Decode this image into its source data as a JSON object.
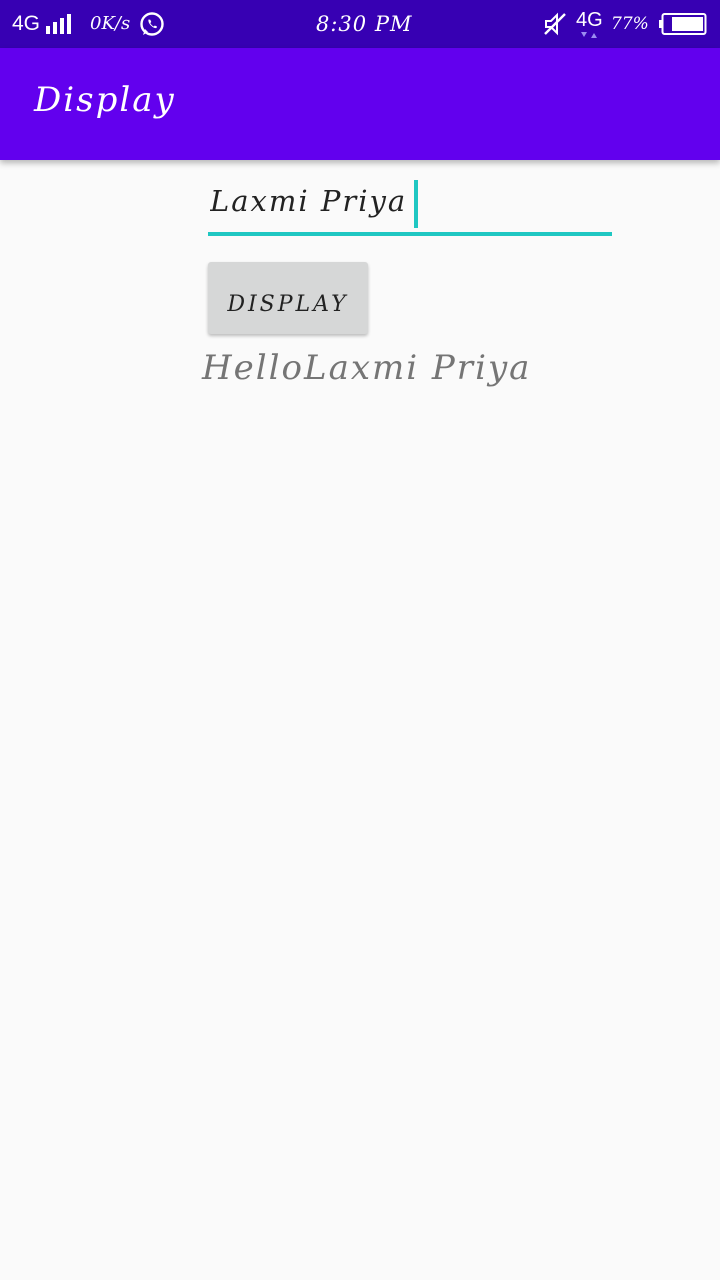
{
  "status_bar": {
    "network_left": "4G",
    "speed": "0K/s",
    "time": "8:30 PM",
    "network_right": "4G",
    "battery": "77%",
    "icons": [
      "signal-icon",
      "whatsapp-icon",
      "mute-icon",
      "data-arrows-icon",
      "battery-icon"
    ]
  },
  "app_bar": {
    "title": "Display",
    "color": "#6200ee"
  },
  "form": {
    "name_value": "Laxmi Priya",
    "accent_color": "#1fc7c2",
    "button_label": "DISPLAY"
  },
  "output": {
    "greeting": "HelloLaxmi Priya"
  }
}
